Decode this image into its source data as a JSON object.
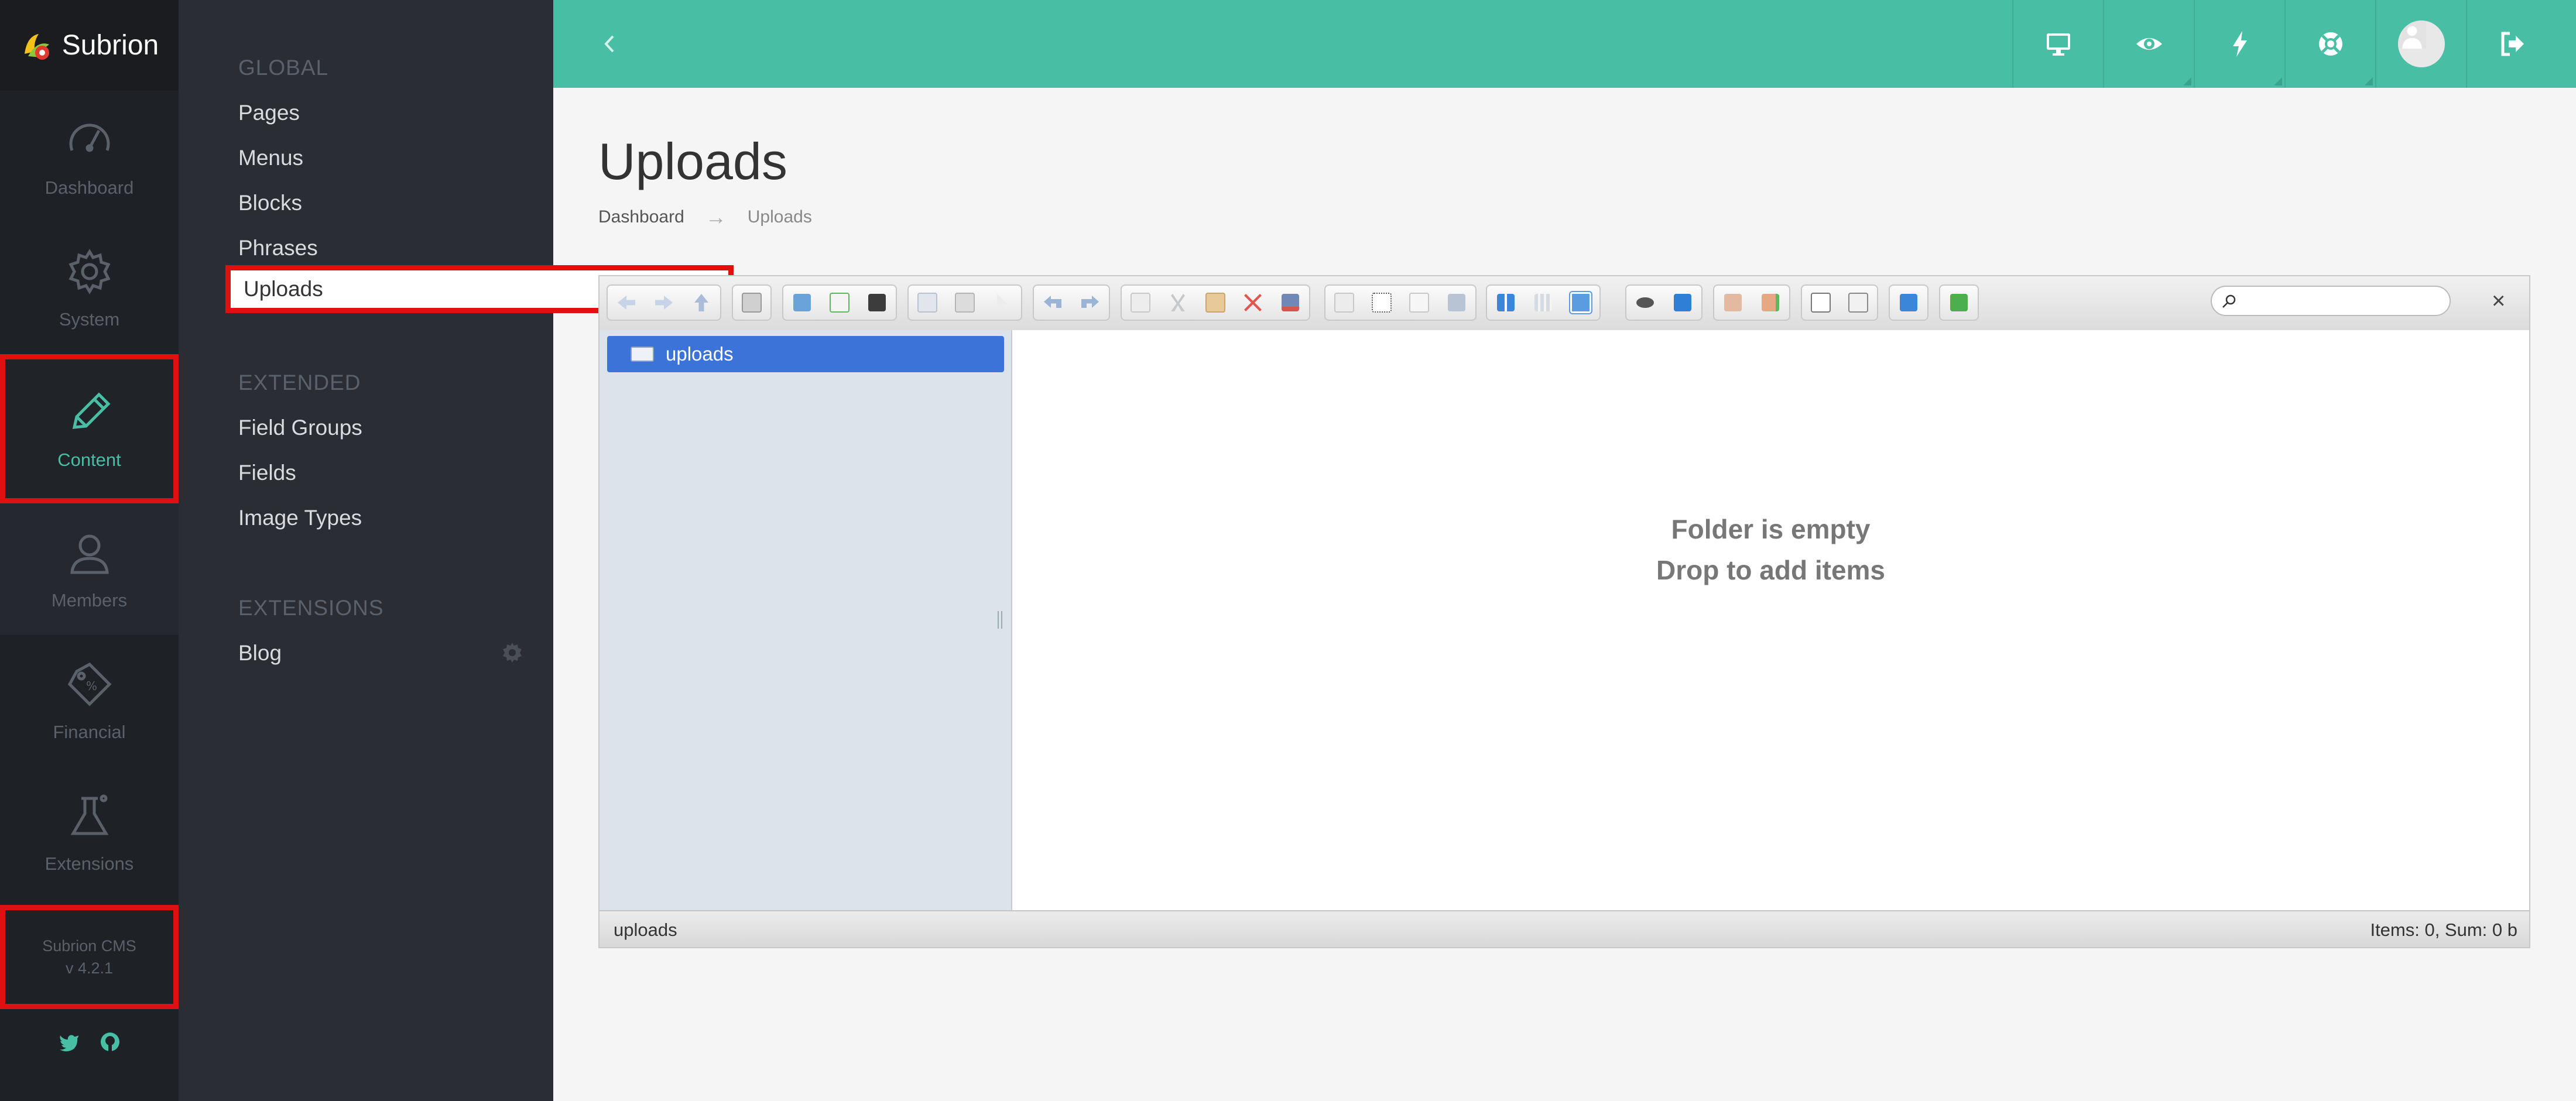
{
  "app": {
    "name": "Subrion",
    "version_line1": "Subrion CMS",
    "version_line2": "v 4.2.1"
  },
  "colors": {
    "accent": "#48bfa5",
    "highlight": "#e01010",
    "sidebar": "#1e2126",
    "submenu": "#2a2d33"
  },
  "sidebar": {
    "items": [
      {
        "label": "Dashboard",
        "icon": "speedometer-icon"
      },
      {
        "label": "System",
        "icon": "gear-icon"
      },
      {
        "label": "Content",
        "icon": "pencil-icon",
        "active": true
      },
      {
        "label": "Members",
        "icon": "user-icon"
      },
      {
        "label": "Financial",
        "icon": "price-tag-icon"
      },
      {
        "label": "Extensions",
        "icon": "flask-icon"
      }
    ],
    "socials": [
      "twitter-icon",
      "github-icon"
    ]
  },
  "submenu": {
    "global_heading": "GLOBAL",
    "global_items": [
      "Pages",
      "Menus",
      "Blocks",
      "Phrases",
      "Uploads"
    ],
    "extended_heading": "EXTENDED",
    "extended_items": [
      "Field Groups",
      "Fields",
      "Image Types"
    ],
    "extensions_heading": "EXTENSIONS",
    "extensions_items": [
      "Blog"
    ]
  },
  "header": {
    "buttons": [
      "monitor-icon",
      "eye-icon",
      "lightning-icon",
      "life-ring-icon",
      "avatar",
      "sign-out-icon"
    ]
  },
  "page": {
    "title": "Uploads",
    "breadcrumb": [
      "Dashboard",
      "Uploads"
    ]
  },
  "file_manager": {
    "search_value": "",
    "tree_root": "uploads",
    "empty_line1": "Folder is empty",
    "empty_line2": "Drop to add items",
    "status_path": "uploads",
    "status_info": "Items: 0, Sum: 0 b"
  }
}
